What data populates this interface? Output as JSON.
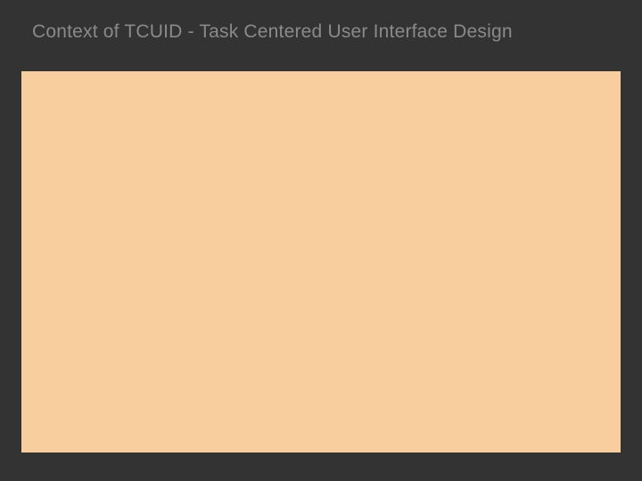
{
  "slide": {
    "title": "Context of TCUID -  Task Centered User Interface Design"
  },
  "colors": {
    "background": "#333333",
    "titleText": "#8a8a8a",
    "panel": "#f8ce9e"
  }
}
